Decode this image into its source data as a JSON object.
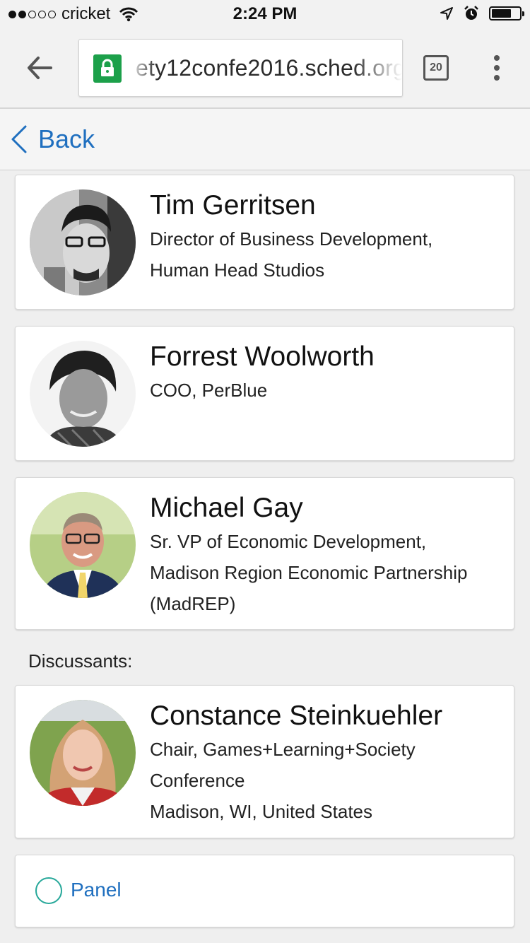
{
  "status_bar": {
    "carrier": "cricket",
    "time": "2:24 PM",
    "signal_bars_filled": 2,
    "signal_bars_total": 5,
    "battery_level": 0.72
  },
  "browser": {
    "url": "ety12confe2016.sched.org",
    "tab_count": "20"
  },
  "nav": {
    "back_label": "Back"
  },
  "speakers": [
    {
      "name": "Tim Gerritsen",
      "lines": [
        "Director of Business Development,",
        "Human Head Studios"
      ]
    },
    {
      "name": "Forrest Woolworth",
      "lines": [
        "COO, PerBlue"
      ]
    },
    {
      "name": "Michael Gay",
      "lines": [
        "Sr. VP of Economic Development,",
        "Madison Region Economic Partnership",
        "(MadREP)"
      ]
    }
  ],
  "discussants_label": "Discussants:",
  "discussants": [
    {
      "name": "Constance Steinkuehler",
      "lines": [
        "Chair, Games+Learning+Society",
        "Conference",
        "Madison, WI, United States"
      ]
    }
  ],
  "session_type": {
    "label": "Panel",
    "color": "#27a89a"
  },
  "colors": {
    "link": "#1f6fbf",
    "lock": "#1ca04a"
  }
}
